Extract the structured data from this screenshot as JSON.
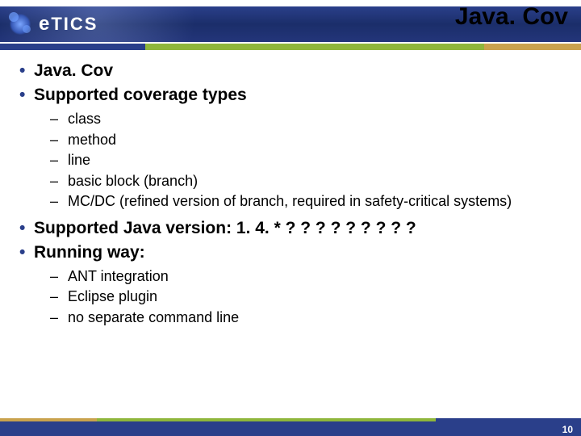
{
  "logo": {
    "text": "eTICS"
  },
  "title": "Java. Cov",
  "b1": [
    {
      "label": "Java. Cov"
    },
    {
      "label": "Supported coverage types"
    }
  ],
  "coverage_types": [
    "class",
    "method",
    "line",
    "basic block (branch)",
    "MC/DC (refined version of branch, required in safety-critical systems)"
  ],
  "b1_after": [
    {
      "label": "Supported Java version: 1. 4. * ? ? ? ? ? ? ? ? ?"
    },
    {
      "label": "Running way:"
    }
  ],
  "running_way": [
    "ANT integration",
    "Eclipse plugin",
    "no separate command line"
  ],
  "page": "10",
  "colors": {
    "accent_blue": "#2a3f8a",
    "accent_green": "#8fb63b",
    "accent_gold": "#c9a24d"
  }
}
